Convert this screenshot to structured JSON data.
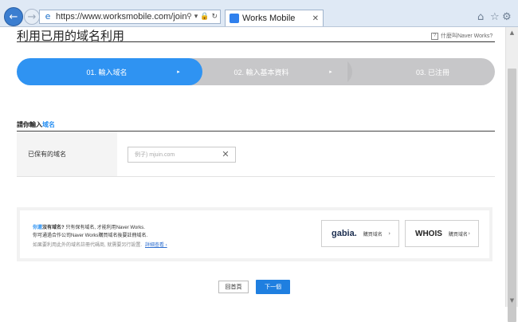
{
  "browser": {
    "url": "https://www.worksmobile.com/joinup/domain?do",
    "tab_title": "Works Mobile",
    "icons": [
      "back-arrow-icon",
      "forward-arrow-icon",
      "search-icon",
      "lock-icon",
      "refresh-icon",
      "close-icon",
      "home-icon",
      "star-icon",
      "gear-icon"
    ]
  },
  "page": {
    "title": "利用已用的域名利用",
    "help_text": "什麼叫Naver Works?"
  },
  "steps": [
    {
      "label": "01. 輸入域名",
      "active": true
    },
    {
      "label": "02. 輸入基本資料",
      "active": false
    },
    {
      "label": "03. 已注冊",
      "active": false
    }
  ],
  "form": {
    "section_title_prefix": "請你輸入",
    "section_title_highlight": "域名",
    "row_label": "已保有的域名",
    "input_placeholder": "例子) mjuin.com",
    "input_value": ""
  },
  "info": {
    "line1_highlight": "你還",
    "line1_bold": "沒有域名?",
    "line1_rest": " 只有保有域名, 才能利用Naver Works.",
    "line2": "你可通過合作公司Naver Works購買域名後要註冊域名.",
    "line3": "如果要利用此外的域名註冊代碼商, 就需要另行設置.",
    "line3_link": "詳細查看 ›",
    "gabia_logo": "gabia.",
    "gabia_label": "購買域名",
    "whois_logo": "WHOIS",
    "whois_label": "購買域名"
  },
  "buttons": {
    "home": "回首頁",
    "next": "下一個"
  },
  "colors": {
    "accent": "#2f93f2",
    "next_button": "#1f7fe0",
    "inactive_step": "#c7c7c9"
  }
}
